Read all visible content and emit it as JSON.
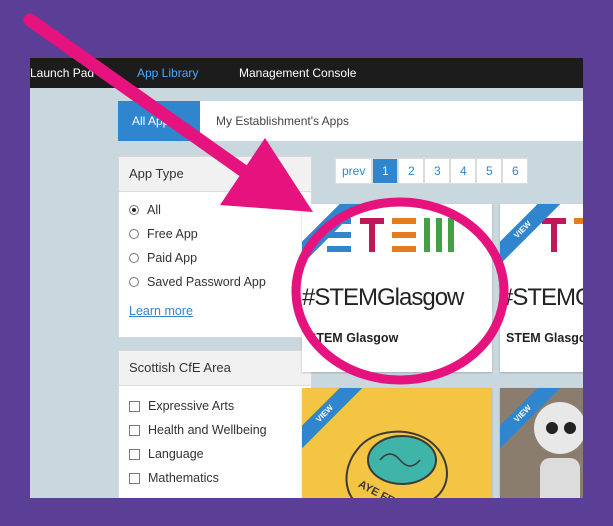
{
  "topbar": {
    "launch": "Launch Pad",
    "library": "App Library",
    "console": "Management Console"
  },
  "tabs": {
    "all": "All Apps",
    "mine": "My Establishment's Apps"
  },
  "app_type": {
    "title": "App Type",
    "options": [
      "All",
      "Free App",
      "Paid App",
      "Saved Password App"
    ],
    "selected": "All",
    "learn_more": "Learn more"
  },
  "cfe": {
    "title": "Scottish CfE Area",
    "options": [
      "Expressive Arts",
      "Health and Wellbeing",
      "Language",
      "Mathematics"
    ]
  },
  "pagination": {
    "prev": "prev",
    "pages": [
      "1",
      "2",
      "3",
      "4",
      "5",
      "6"
    ],
    "current": "1"
  },
  "cards": [
    {
      "title": "STEM Glasgow",
      "hashtag": "#STEMGlasgow",
      "ribbon": "VIEW"
    },
    {
      "title": "STEM Glasgow",
      "hashtag": "#STEMGlasgow",
      "ribbon": "VIEW"
    },
    {
      "ribbon": "VIEW",
      "caption": "AYE FEEL"
    },
    {
      "ribbon": "VIEW"
    }
  ],
  "colors": {
    "frame": "#5b3f97",
    "accent": "#2f86cf",
    "arrow": "#e6127d",
    "topbar": "#1c1c1c"
  }
}
